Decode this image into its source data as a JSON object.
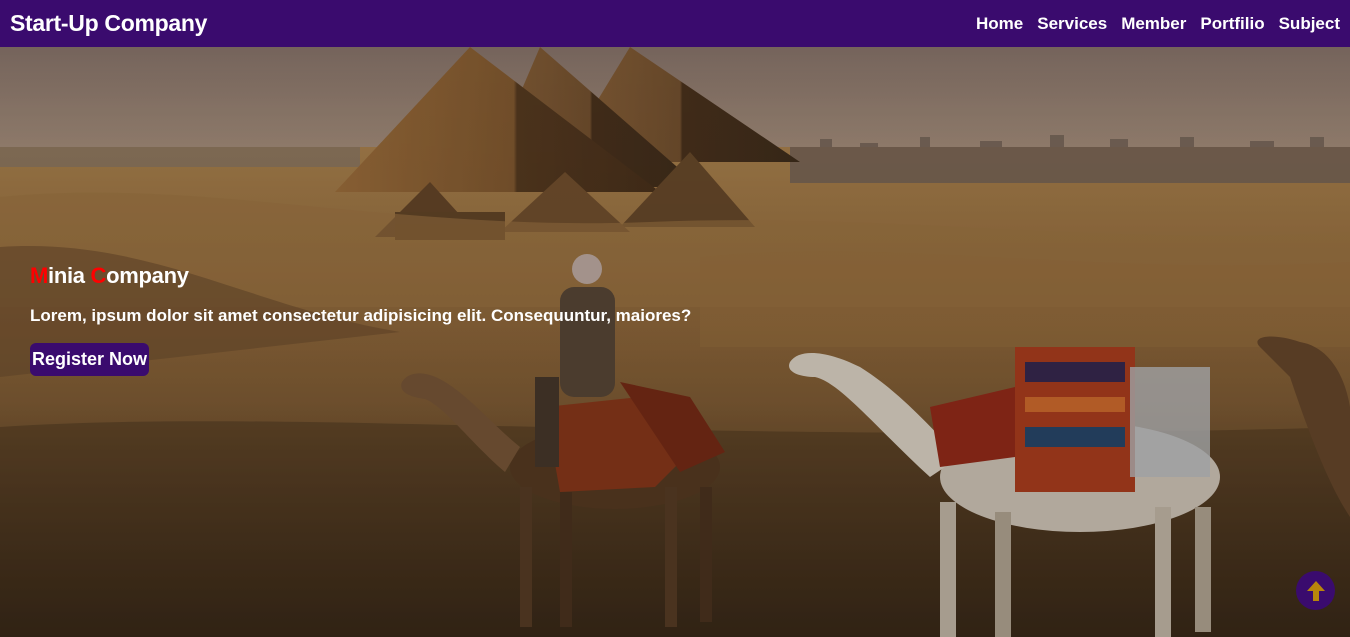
{
  "navbar": {
    "brand": "Start-Up Company",
    "links": [
      "Home",
      "Services",
      "Member",
      "Portfilio",
      "Subject"
    ]
  },
  "hero": {
    "title_first_initial": "M",
    "title_first_rest": "inia ",
    "title_second_initial": "C",
    "title_second_rest": "ompany",
    "text": "Lorem, ipsum dolor sit amet consectetur adipisicing elit. Consequuntur, maiores?",
    "button_label": "Register Now",
    "background_icon": "pyramids-and-camels-photo"
  },
  "scroll_top": {
    "icon": "arrow-up-icon"
  },
  "colors": {
    "nav_bg": "#3a0b6e",
    "accent": "#ff0000",
    "text": "#ffffff",
    "button_bg": "#3a0b6e",
    "icon_arrow": "#b8860b"
  }
}
